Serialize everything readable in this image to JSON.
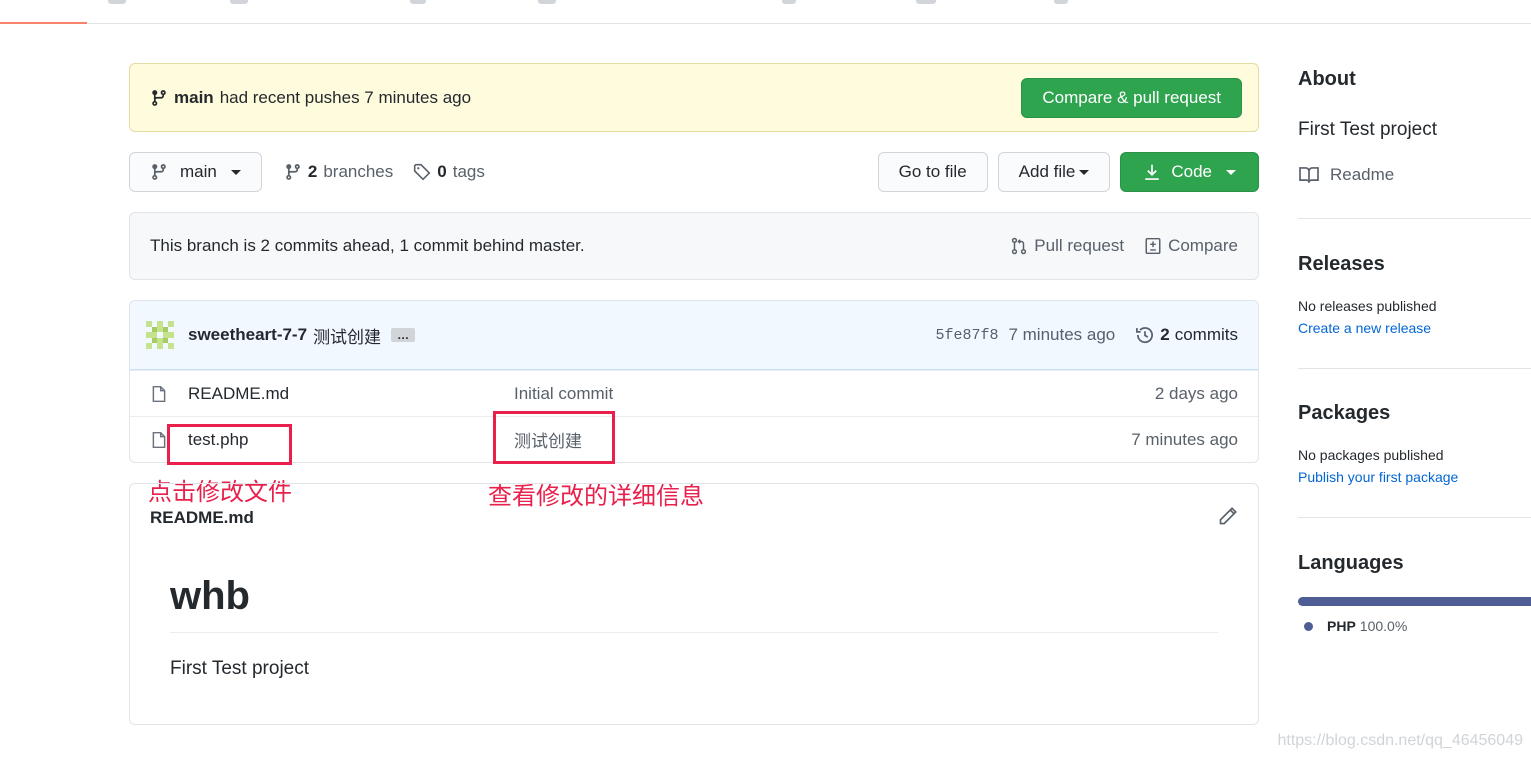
{
  "colors": {
    "accent_green": "#2ea44f",
    "banner_bg": "#fffbdd",
    "annotation_red": "#e8204b",
    "link_blue": "#0366d6",
    "php_color": "#4f5d95"
  },
  "banner": {
    "branch": "main",
    "text": "had recent pushes 7 minutes ago",
    "button": "Compare & pull request"
  },
  "toolbar": {
    "branch_selector": "main",
    "branches_count": "2",
    "branches_label": "branches",
    "tags_count": "0",
    "tags_label": "tags",
    "go_to_file": "Go to file",
    "add_file": "Add file",
    "code": "Code"
  },
  "branch_info": {
    "text": "This branch is 2 commits ahead, 1 commit behind master.",
    "pull_request": "Pull request",
    "compare": "Compare"
  },
  "latest_commit": {
    "author": "sweetheart-7-7",
    "message": "测试创建",
    "ellipsis": "…",
    "sha": "5fe87f8",
    "age": "7 minutes ago",
    "commits_count": "2",
    "commits_label": "commits"
  },
  "files": [
    {
      "name": "README.md",
      "message": "Initial commit",
      "age": "2 days ago"
    },
    {
      "name": "test.php",
      "message": "测试创建",
      "age": "7 minutes ago"
    }
  ],
  "annotations": {
    "click_file": "点击修改文件",
    "view_details": "查看修改的详细信息"
  },
  "readme": {
    "title": "README.md",
    "heading": "whb",
    "body": "First Test project"
  },
  "sidebar": {
    "about_title": "About",
    "about_desc": "First Test project",
    "readme_link": "Readme",
    "releases_title": "Releases",
    "releases_none": "No releases published",
    "releases_link": "Create a new release",
    "packages_title": "Packages",
    "packages_none": "No packages published",
    "packages_link": "Publish your first package",
    "languages_title": "Languages",
    "language_name": "PHP",
    "language_pct": "100.0%"
  },
  "watermark": "https://blog.csdn.net/qq_46456049"
}
